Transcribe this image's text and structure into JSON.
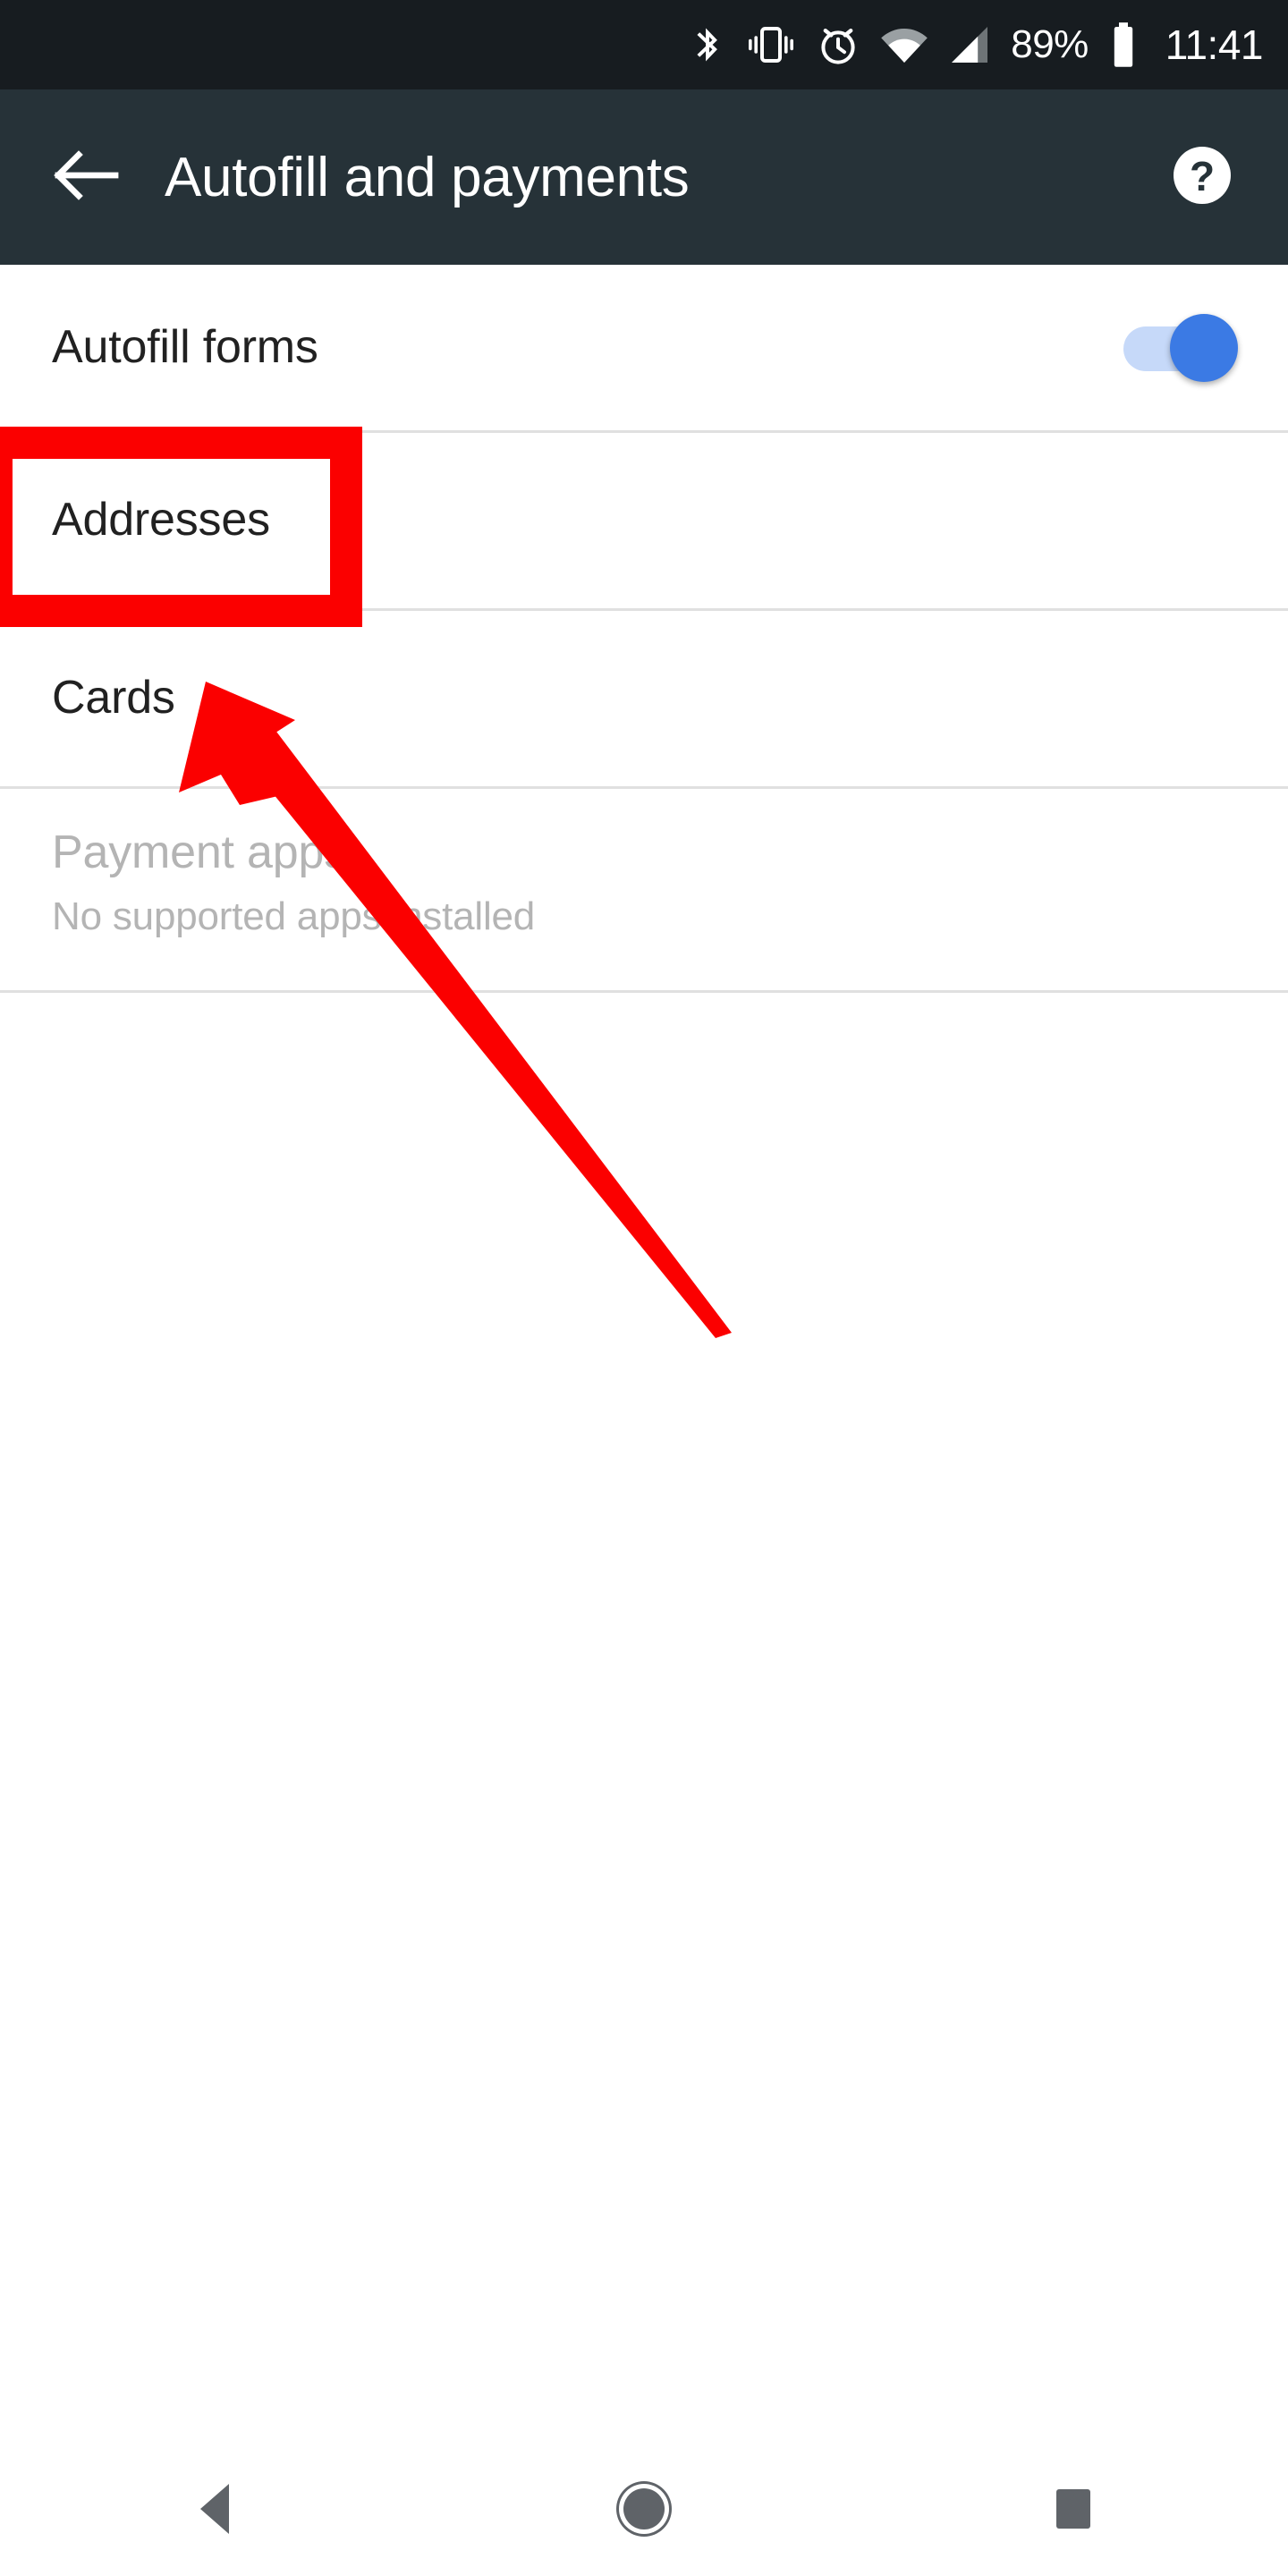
{
  "status_bar": {
    "background": "#171c20",
    "icons": [
      "bluetooth-icon",
      "vibrate-icon",
      "alarm-icon",
      "wifi-icon",
      "cell-signal-icon",
      "battery-icon"
    ],
    "battery_percent": "89%",
    "clock": "11:41"
  },
  "app_bar": {
    "background": "#263238",
    "title": "Autofill and payments",
    "back_icon": "arrow-left-icon",
    "help_icon": "help-circle-icon"
  },
  "settings": {
    "autofill_forms": {
      "label": "Autofill forms",
      "toggle_state": "on",
      "toggle_track_color": "#c6d9f9",
      "toggle_thumb_color": "#3b7ae4"
    },
    "addresses": {
      "label": "Addresses"
    },
    "cards": {
      "label": "Cards"
    },
    "payment_apps": {
      "label": "Payment apps",
      "subtitle": "No supported apps installed",
      "state": "disabled",
      "text_color": "#b4b4b4"
    }
  },
  "annotation": {
    "highlight_color": "#fb0000",
    "highlight_target": "Addresses",
    "arrow_color": "#fb0000",
    "arrow_points_to": "Addresses"
  },
  "nav_bar": {
    "background": "#ffffff",
    "buttons": [
      "back-triangle-icon",
      "home-circle-icon",
      "recents-square-icon"
    ],
    "icon_color": "#5f6368"
  }
}
